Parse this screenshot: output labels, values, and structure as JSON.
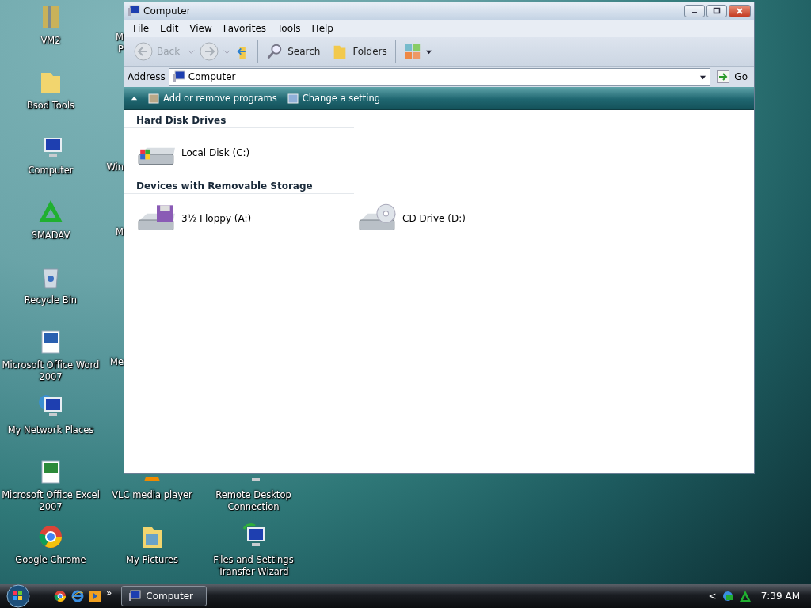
{
  "desktop": {
    "columns": [
      {
        "items": [
          {
            "lines": [
              "VM2"
            ],
            "kind": "archive"
          },
          {
            "lines": [
              "Bsod Tools"
            ],
            "kind": "folder"
          },
          {
            "lines": [
              "Computer"
            ],
            "kind": "computer"
          },
          {
            "lines": [
              "SMADAV"
            ],
            "kind": "smadav"
          },
          {
            "lines": [
              "Recycle Bin"
            ],
            "kind": "bin"
          },
          {
            "lines": [
              "Microsoft Office Word",
              "2007"
            ],
            "kind": "word"
          },
          {
            "lines": [
              "My Network Places"
            ],
            "kind": "network"
          },
          {
            "lines": [
              "Microsoft Office Excel",
              "2007"
            ],
            "kind": "excel"
          },
          {
            "lines": [
              "Google Chrome"
            ],
            "kind": "chrome"
          }
        ]
      },
      {
        "items": [
          {
            "lines": [
              "M",
              "P"
            ],
            "kind": "hidden"
          },
          {
            "lines": [
              "Win"
            ],
            "kind": "hidden"
          },
          {
            "lines": [
              "M"
            ],
            "kind": "hidden"
          },
          {
            "lines": [
              "Me"
            ],
            "kind": "hidden"
          },
          {
            "lines": [
              "VLC media player"
            ],
            "kind": "vlc",
            "partial": true
          },
          {
            "lines": [
              "My Pictures"
            ],
            "kind": "pictures"
          }
        ]
      },
      {
        "items": [
          {
            "lines": [
              "Remote Desktop",
              "Connection"
            ],
            "kind": "remote",
            "partial": true
          },
          {
            "lines": [
              "Files and Settings",
              "Transfer Wizard"
            ],
            "kind": "transfer"
          }
        ]
      }
    ]
  },
  "window": {
    "title": "Computer",
    "menu": [
      "File",
      "Edit",
      "View",
      "Favorites",
      "Tools",
      "Help"
    ],
    "toolbar": {
      "back": {
        "label": "Back",
        "disabled": true
      },
      "search": "Search",
      "folders": "Folders"
    },
    "address": {
      "label": "Address",
      "value": "Computer",
      "go": "Go"
    },
    "commands": [
      "Add or remove programs",
      "Change a setting"
    ],
    "groups": [
      {
        "title": "Hard Disk Drives",
        "items": [
          {
            "label": "Local Disk (C:)",
            "kind": "hdd"
          }
        ]
      },
      {
        "title": "Devices with Removable Storage",
        "items": [
          {
            "label": "3½ Floppy (A:)",
            "kind": "floppy"
          },
          {
            "label": "CD Drive (D:)",
            "kind": "cd"
          }
        ]
      }
    ]
  },
  "taskbar": {
    "more": "»",
    "tasks": [
      {
        "label": "Computer",
        "selected": true
      }
    ],
    "tray_chevron": "<",
    "clock": "7:39 AM"
  }
}
